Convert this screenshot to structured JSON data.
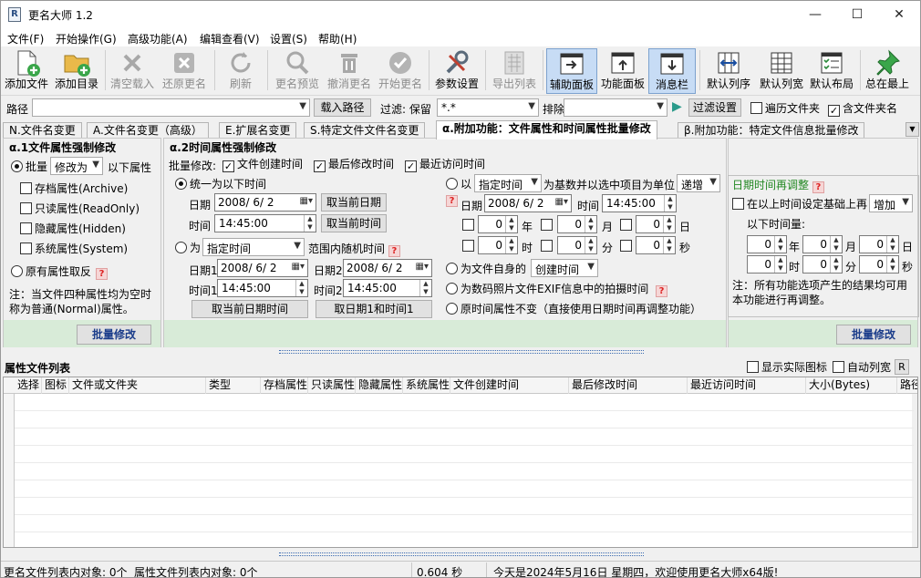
{
  "window": {
    "title": "更名大师 1.2",
    "minimize": "—",
    "maximize": "☐",
    "close": "✕"
  },
  "menu": [
    "文件(F)",
    "开始操作(G)",
    "高级功能(A)",
    "编辑查看(V)",
    "设置(S)",
    "帮助(H)"
  ],
  "toolbar": [
    {
      "label": "添加文件",
      "icon": "add-file-icon"
    },
    {
      "label": "添加目录",
      "icon": "add-folder-icon"
    },
    {
      "label": "清空载入",
      "icon": "clear-icon"
    },
    {
      "label": "还原更名",
      "icon": "undo-rename-icon"
    },
    {
      "label": "刷新",
      "icon": "refresh-icon"
    },
    {
      "label": "更名预览",
      "icon": "preview-icon"
    },
    {
      "label": "撤消更名",
      "icon": "revoke-icon"
    },
    {
      "label": "开始更名",
      "icon": "start-icon"
    },
    {
      "label": "参数设置",
      "icon": "tools-icon"
    },
    {
      "label": "导出列表",
      "icon": "export-icon"
    },
    {
      "label": "辅助面板",
      "icon": "aux-panel-icon"
    },
    {
      "label": "功能面板",
      "icon": "func-panel-icon"
    },
    {
      "label": "消息栏",
      "icon": "message-bar-icon"
    },
    {
      "label": "默认列序",
      "icon": "column-order-icon"
    },
    {
      "label": "默认列宽",
      "icon": "column-width-icon"
    },
    {
      "label": "默认布局",
      "icon": "layout-icon"
    },
    {
      "label": "总在最上",
      "icon": "pin-icon"
    }
  ],
  "pathbar": {
    "path_label": "路径",
    "path_value": "",
    "load_button": "载入路径",
    "filter_label": "过滤: 保留",
    "filter_value": "*.*",
    "exclude_label": "排除",
    "exclude_value": "",
    "filter_button": "过滤设置",
    "traverse": "遍历文件夹",
    "include_folder": "含文件夹名"
  },
  "tabs": [
    "N.文件名变更",
    "A.文件名变更（高级）",
    "E.扩展名变更",
    "S.特定文件文件名变更",
    "α.附加功能：文件属性和时间属性批量修改",
    "β.附加功能：特定文件信息批量修改"
  ],
  "left": {
    "title": "α.1文件属性强制修改",
    "batch": "批量",
    "modify_option": "修改为",
    "attr_suffix": "以下属性",
    "attrs": [
      "存档属性(Archive)",
      "只读属性(ReadOnly)",
      "隐藏属性(Hidden)",
      "系统属性(System)"
    ],
    "invert": "原有属性取反",
    "note": "注：当文件四种属性均为空时称为普通(Normal)属性。",
    "button": "批量修改"
  },
  "mid": {
    "title": "α.2时间属性强制修改",
    "batch_label": "批量修改:",
    "chk_create": "文件创建时间",
    "chk_modify": "最后修改时间",
    "chk_access": "最近访问时间",
    "unify": "统一为以下时间",
    "date_label": "日期",
    "date_value": "2008/ 6/ 2",
    "time_label": "时间",
    "time_value": "14:45:00",
    "cur_date_btn": "取当前日期",
    "cur_time_btn": "取当前时间",
    "random_prefix": "为",
    "random_combo": "指定时间",
    "random_suffix": "范围内随机时间",
    "date1_label": "日期1",
    "date2_label": "日期2",
    "time1_label": "时间1",
    "time2_label": "时间2",
    "cur_datetime_btn": "取当前日期时间",
    "take_date1_btn": "取日期1和时间1",
    "base_prefix": "以",
    "base_combo": "指定时间",
    "base_suffix": "为基数并以选中项目为单位",
    "base_mode": "递增",
    "spin_units": [
      "年",
      "月",
      "日",
      "时",
      "分",
      "秒"
    ],
    "spin_value": "0",
    "self_prefix": "为文件自身的",
    "self_combo": "创建时间",
    "exif": "为数码照片文件EXIF信息中的拍摄时间",
    "keep": "原时间属性不变（直接使用日期时间再调整功能）",
    "button": "批量修改"
  },
  "right": {
    "title": "日期时间再调整",
    "base_chk": "在以上时间设定基础上再",
    "mode": "增加",
    "sub_label": "以下时间量:",
    "spin_units": [
      "年",
      "月",
      "日",
      "时",
      "分",
      "秒"
    ],
    "spin_value": "0",
    "note": "注：所有功能选项产生的结果均可用本功能进行再调整。",
    "button": "批量修改"
  },
  "filelist": {
    "title": "属性文件列表",
    "show_icon": "显示实际图标",
    "auto_width": "自动列宽",
    "r_button": "R",
    "columns": [
      "选择",
      "图标",
      "文件或文件夹",
      "类型",
      "存档属性",
      "只读属性",
      "隐藏属性",
      "系统属性",
      "文件创建时间",
      "最后修改时间",
      "最近访问时间",
      "大小(Bytes)",
      "路径"
    ]
  },
  "status": {
    "left": "更名文件列表内对象: 0个",
    "attr": "属性文件列表内对象: 0个",
    "time": "0.604 秒",
    "message": "今天是2024年5月16日 星期四，欢迎使用更名大师x64版!"
  },
  "colors": {
    "accent": "#1a3c8a",
    "green_bar": "#d8ebd8",
    "title_green": "#228822",
    "active_btn": "#c7dcf5"
  }
}
